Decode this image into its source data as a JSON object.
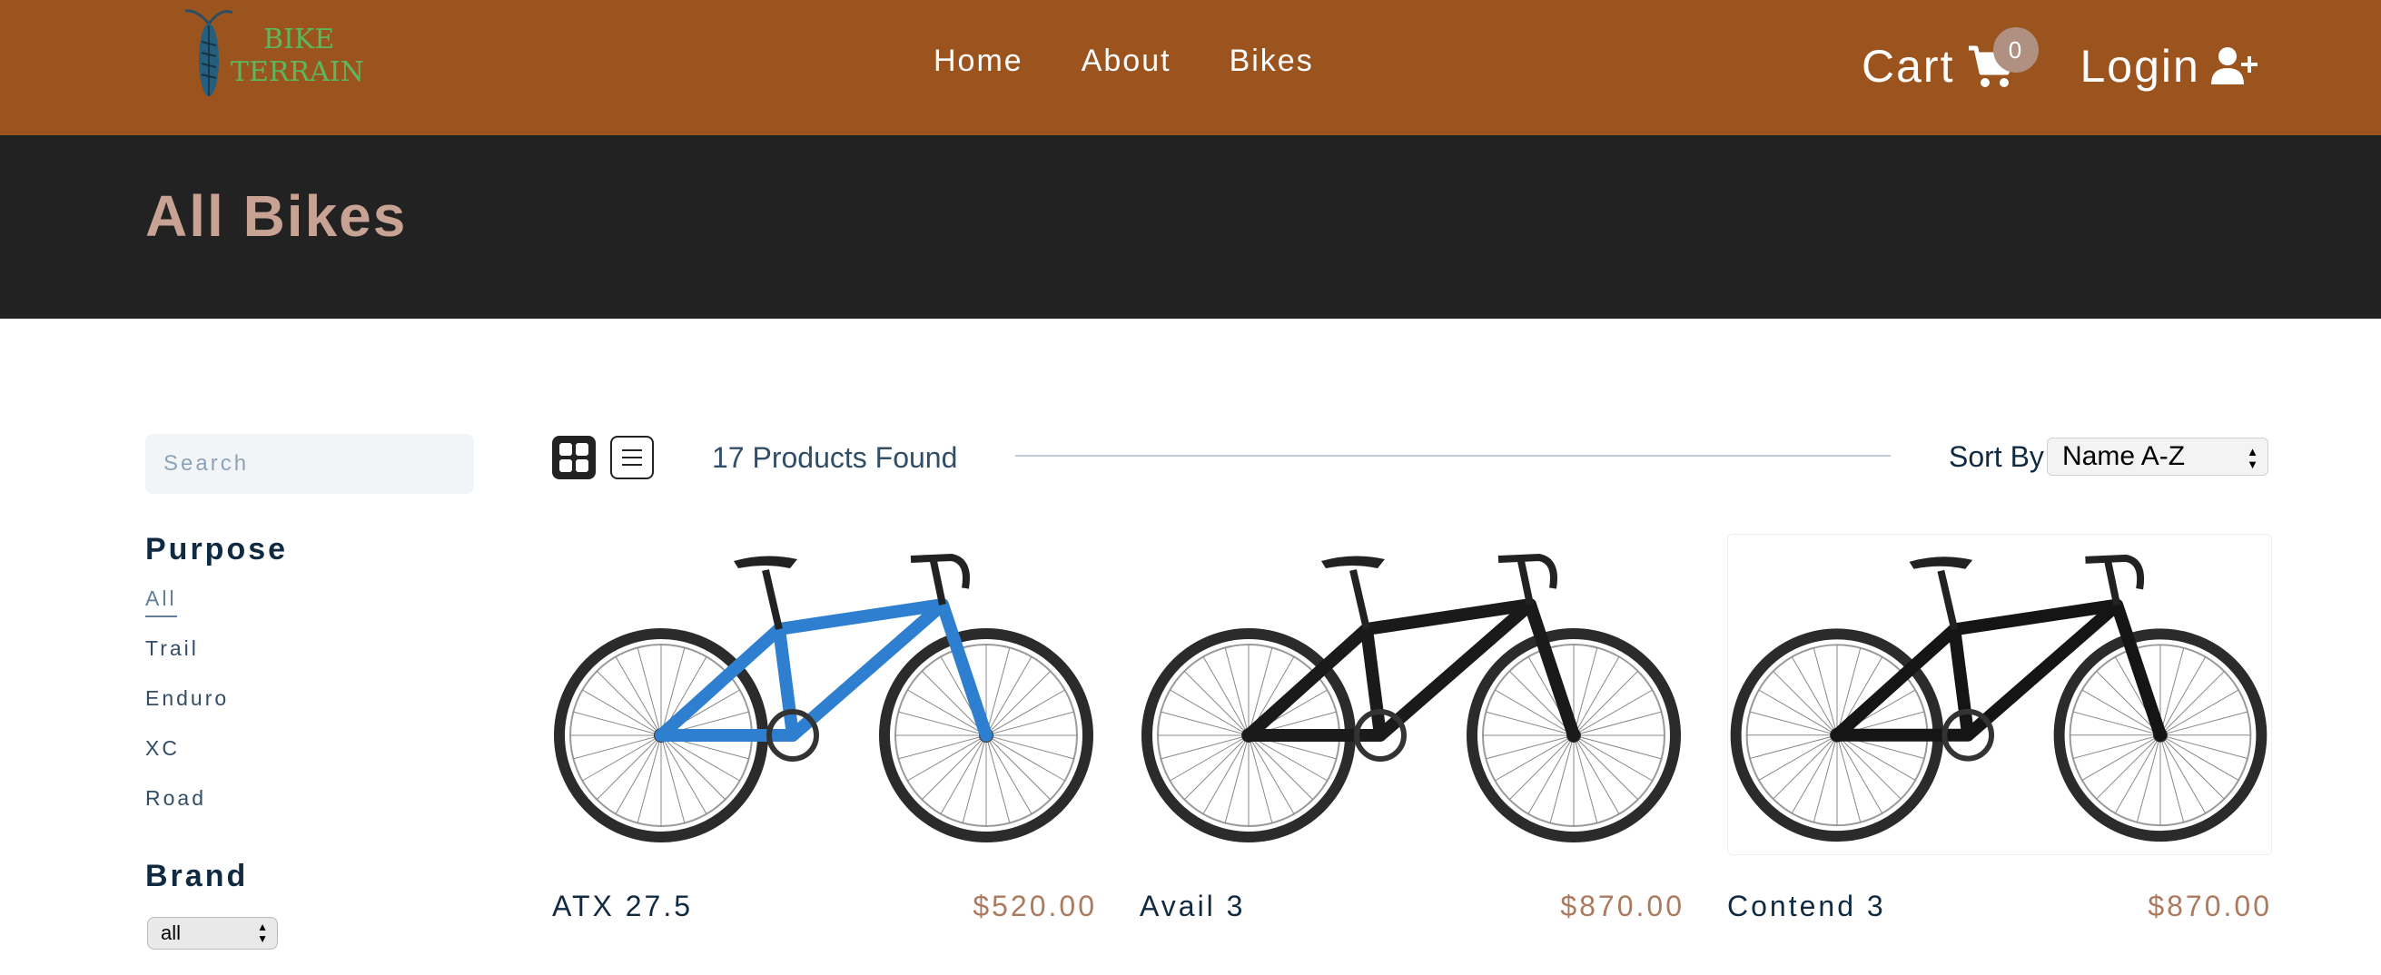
{
  "brand": {
    "line1": "BIKE",
    "line2": "TERRAIN"
  },
  "nav": {
    "links": [
      "Home",
      "About",
      "Bikes"
    ],
    "cart_label": "Cart",
    "cart_count": "0",
    "login_label": "Login"
  },
  "hero": {
    "title": "All Bikes"
  },
  "filters": {
    "search_placeholder": "Search",
    "purpose_title": "Purpose",
    "purpose_items": [
      "All",
      "Trail",
      "Enduro",
      "XC",
      "Road"
    ],
    "brand_title": "Brand",
    "brand_value": "all"
  },
  "toolbar": {
    "count_text": "17 Products Found",
    "sort_label": "Sort By",
    "sort_value": "Name A-Z"
  },
  "products": [
    {
      "name": "ATX 27.5",
      "price": "$520.00",
      "frame_color": "#2e7fd0"
    },
    {
      "name": "Avail 3",
      "price": "$870.00",
      "frame_color": "#1a1a1a"
    },
    {
      "name": "Contend 3",
      "price": "$870.00",
      "frame_color": "#151515"
    }
  ],
  "colors": {
    "navbar": "#9c541f",
    "hero": "#222222",
    "hero_title": "#c8a394",
    "price": "#ab7a5f",
    "logo_text": "#5cb85c"
  }
}
